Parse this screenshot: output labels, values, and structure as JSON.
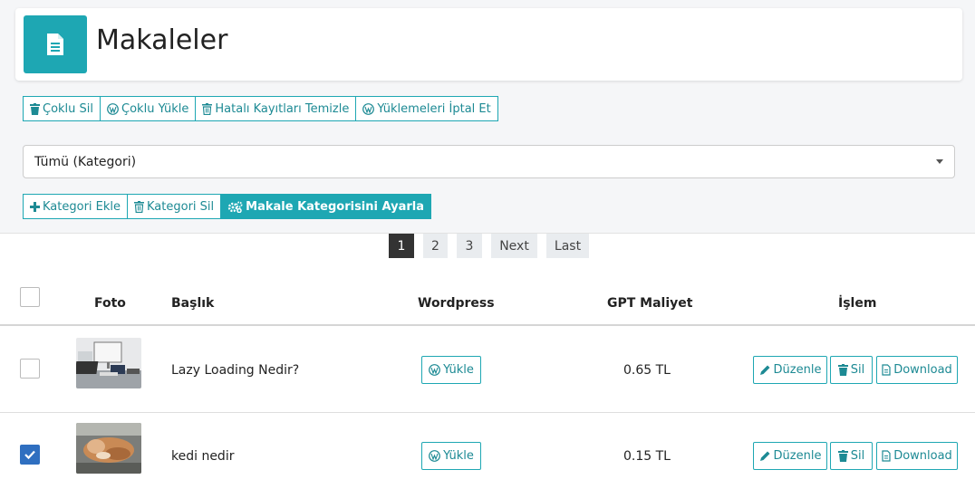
{
  "page": {
    "title": "Makaleler"
  },
  "toolbar": {
    "bulk_delete": "Çoklu Sil",
    "bulk_upload": "Çoklu Yükle",
    "clean_errors": "Hatalı Kayıtları Temizle",
    "cancel_uploads": "Yüklemeleri İptal Et"
  },
  "category_select": {
    "value": "Tümü (Kategori)"
  },
  "category_toolbar": {
    "add": "Kategori Ekle",
    "delete": "Kategori Sil",
    "set": "Makale Kategorisini Ayarla"
  },
  "pagination": {
    "pages": [
      "1",
      "2",
      "3"
    ],
    "next": "Next",
    "last": "Last",
    "current": "1"
  },
  "table": {
    "headers": {
      "photo": "Foto",
      "title": "Başlık",
      "wordpress": "Wordpress",
      "cost": "GPT Maliyet",
      "action": "İşlem"
    },
    "rows": [
      {
        "title": "Lazy Loading Nedir?",
        "upload": "Yükle",
        "cost": "0.65 TL",
        "edit": "Düzenle",
        "delete": "Sil",
        "download": "Download",
        "checked": false
      },
      {
        "title": "kedi nedir",
        "upload": "Yükle",
        "cost": "0.15 TL",
        "edit": "Düzenle",
        "delete": "Sil",
        "download": "Download",
        "checked": true
      }
    ]
  },
  "colors": {
    "accent": "#1ea7b3",
    "checkbox_checked": "#2f6fc0",
    "pager_active": "#333333"
  }
}
